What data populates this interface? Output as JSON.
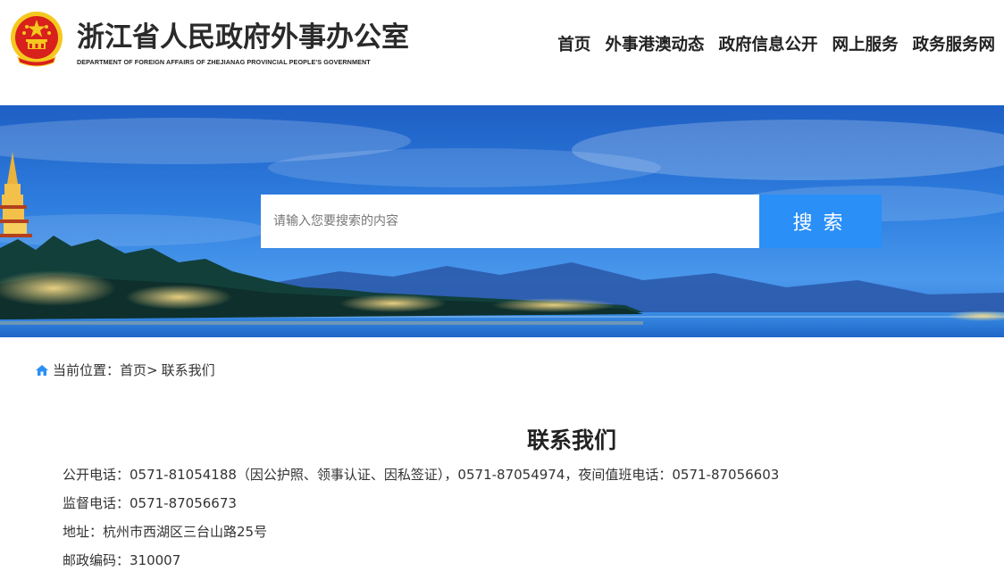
{
  "header": {
    "title": "浙江省人民政府外事办公室",
    "subtitle": "DEPARTMENT OF FOREIGN AFFAIRS OF ZHEJIANAG PROVINCIAL PEOPLE'S GOVERNMENT",
    "emblem_icon": "national-emblem-icon",
    "nav": [
      {
        "label": "首页"
      },
      {
        "label": "外事港澳动态"
      },
      {
        "label": "政府信息公开"
      },
      {
        "label": "网上服务"
      },
      {
        "label": "政务服务网"
      }
    ]
  },
  "search": {
    "placeholder": "请输入您要搜索的内容",
    "value": "",
    "button_label": "搜索"
  },
  "breadcrumb": {
    "icon": "home-icon",
    "prefix": "当前位置：",
    "home": "首页",
    "separator": ">",
    "current": "联系我们"
  },
  "page": {
    "title": "联系我们",
    "lines": [
      "公开电话：0571-81054188（因公护照、领事认证、因私签证），0571-87054974，夜间值班电话：0571-87056603",
      "监督电话：0571-87056673",
      "地址：杭州市西湖区三台山路25号",
      "邮政编码：310007"
    ]
  },
  "colors": {
    "accent": "#2a8ff7",
    "emblem_red": "#d8201c",
    "emblem_gold": "#f5c81e"
  }
}
